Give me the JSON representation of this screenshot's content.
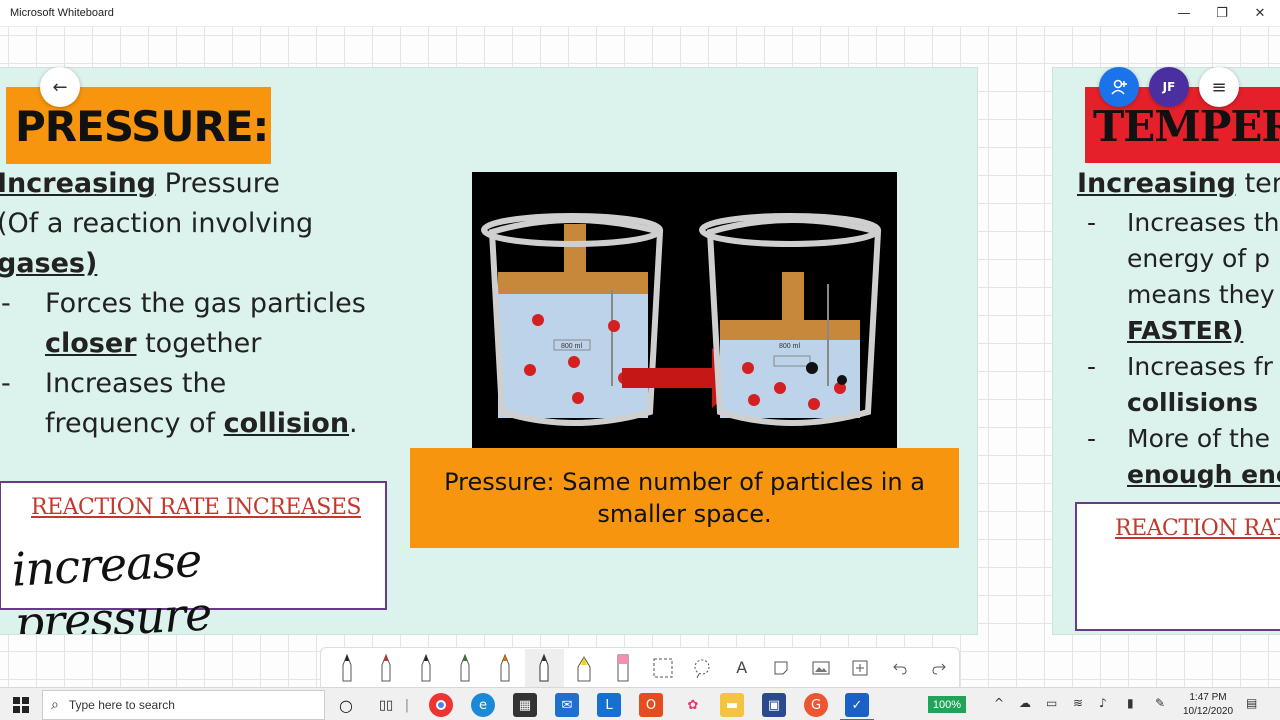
{
  "window": {
    "title": "Microsoft Whiteboard",
    "minimize_glyph": "—",
    "restore_glyph": "❐",
    "close_glyph": "✕"
  },
  "slide1": {
    "title": "PRESSURE:",
    "line1_bold": "Increasing",
    "line1_rest": " Pressure",
    "line2": "(Of a reaction involving",
    "line3": "gases)",
    "bullet_dash": "-",
    "bullet1_line1": "Forces the gas particles",
    "bullet1_line2_bold": "closer",
    "bullet1_line2_rest": " together",
    "bullet2_line1": "Increases the",
    "bullet2_line2_pre": "frequency of ",
    "bullet2_line2_bold": "collision",
    "bullet2_line2_post": ".",
    "reaction_rate_label": "REACTION RATE INCREASES",
    "handwriting": "increase pressure",
    "beaker_label_left": "800 ml",
    "beaker_label_right": "800 ml",
    "caption": "Pressure: Same number of particles in a smaller space."
  },
  "slide2": {
    "title": "TEMPERA",
    "line1_bold": "Increasing",
    "line1_rest": " ten",
    "bullet_dash": "-",
    "b1_l1": "Increases th",
    "b1_l2": "energy of p",
    "b1_l3": "means they",
    "b1_l4_bold": "FASTER)",
    "b2_l1": "Increases fr",
    "b2_l2_bold": "collisions",
    "b3_l1": "More of the",
    "b3_l2_bold": "enough ene",
    "reaction_rate_label": "REACTION RAT"
  },
  "floating": {
    "back_glyph": "←",
    "user_initials": "JF",
    "menu_glyph": "≡"
  },
  "toolbar": {
    "pen_colors": [
      "#222222",
      "#d32f2f",
      "#222222",
      "#2e7d32",
      "#ef6c00",
      "#333333"
    ],
    "highlighter_color": "#f3d21f",
    "eraser_color": "#f48fb1",
    "text_tool": "A"
  },
  "taskbar": {
    "search_placeholder": "Type here to search",
    "zoom": "100%",
    "time": "1:47 PM",
    "date": "10/12/2020"
  }
}
